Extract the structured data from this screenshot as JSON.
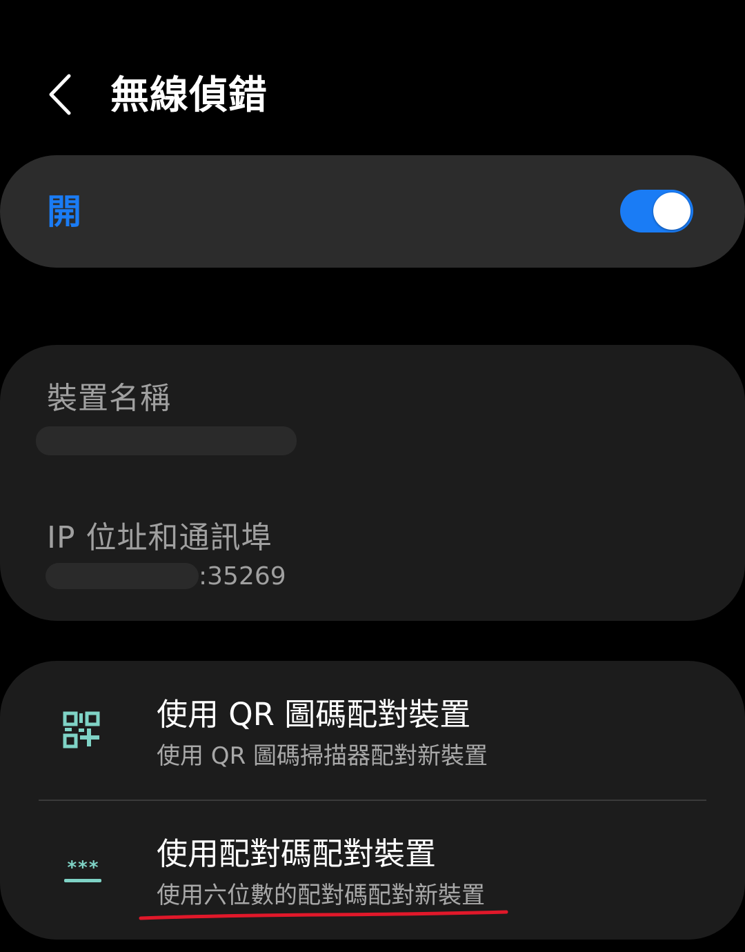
{
  "header": {
    "title": "無線偵錯"
  },
  "toggle": {
    "label": "開",
    "state": "on",
    "accent_color": "#1a7cf5"
  },
  "device_info": {
    "name_title": "裝置名稱",
    "name_value": "",
    "ip_title": "IP 位址和通訊埠",
    "ip_port_suffix": ":35269"
  },
  "pairing": {
    "qr": {
      "title": "使用 QR 圖碼配對裝置",
      "subtitle": "使用 QR 圖碼掃描器配對新裝置",
      "icon": "qr-code-icon"
    },
    "code": {
      "title": "使用配對碼配對裝置",
      "subtitle": "使用六位數的配對碼配對新裝置",
      "icon": "password-icon"
    },
    "icon_color": "#7fd3c6"
  },
  "annotation_color": "#e0182a"
}
